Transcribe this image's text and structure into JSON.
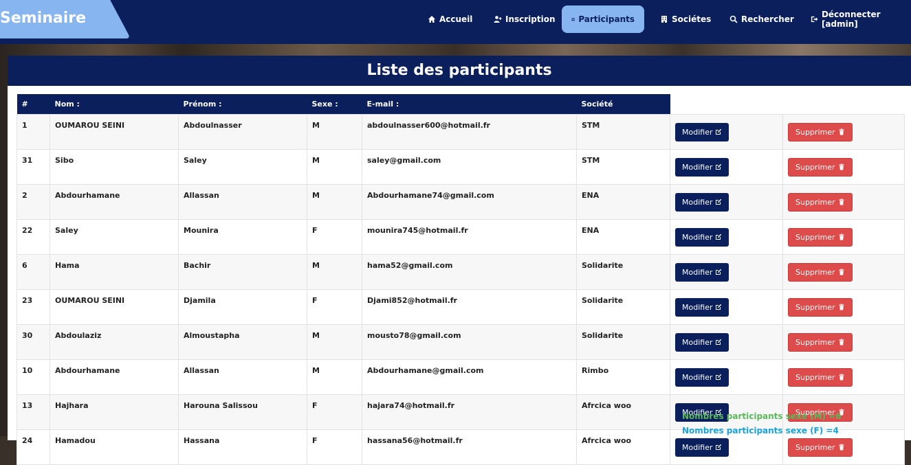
{
  "brand": "Seminaire",
  "nav": [
    {
      "label": "Accueil",
      "icon": "home-icon"
    },
    {
      "label": "Inscription",
      "icon": "user-plus-icon"
    },
    {
      "label": "Participants",
      "icon": "users-icon",
      "active": true
    },
    {
      "label": "Sociétes",
      "icon": "building-icon"
    },
    {
      "label": "Rechercher",
      "icon": "search-icon"
    },
    {
      "label": "Déconnecter [admin]",
      "icon": "sign-out-icon"
    }
  ],
  "panel": {
    "title": "Liste des participants"
  },
  "table": {
    "headers": [
      "#",
      "Nom :",
      "Prénom :",
      "Sexe :",
      "E-mail :",
      "Société"
    ],
    "modify_label": "Modifier",
    "delete_label": "Supprimer",
    "rows": [
      [
        "1",
        "OUMAROU SEINI",
        "Abdoulnasser",
        "M",
        "abdoulnasser600@hotmail.fr",
        "STM"
      ],
      [
        "31",
        "Sibo",
        "Saley",
        "M",
        "saley@gmail.com",
        "STM"
      ],
      [
        "2",
        "Abdourhamane",
        "Allassan",
        "M",
        "Abdourhamane74@gmail.com",
        "ENA"
      ],
      [
        "22",
        "Saley",
        "Mounira",
        "F",
        "mounira745@hotmail.fr",
        "ENA"
      ],
      [
        "6",
        "Hama",
        "Bachir",
        "M",
        "hama52@gmail.com",
        "Solidarite"
      ],
      [
        "23",
        "OUMAROU SEINI",
        "Djamila",
        "F",
        "Djami852@hotmail.fr",
        "Solidarite"
      ],
      [
        "30",
        "Abdoulaziz",
        "Almoustapha",
        "M",
        "mousto78@gmail.com",
        "Solidarite"
      ],
      [
        "10",
        "Abdourhamane",
        "Allassan",
        "M",
        "Abdourhamane@gmail.com",
        "Rimbo"
      ],
      [
        "13",
        "Hajhara",
        "Harouna Salissou",
        "F",
        "hajara74@hotmail.fr",
        "Afrcica woo"
      ],
      [
        "24",
        "Hamadou",
        "Hassana",
        "F",
        "hassana56@hotmail.fr",
        "Afrcica woo"
      ]
    ]
  },
  "stats": {
    "male": "Nombres participants sexe (M) =6",
    "female": "Nombres participants sexe (F) =4"
  },
  "colors": {
    "navy": "#0a1f5c",
    "accent": "#86b5f0",
    "danger": "#dd4b4b",
    "green": "#5cb85c",
    "blue": "#1aa3d9"
  }
}
